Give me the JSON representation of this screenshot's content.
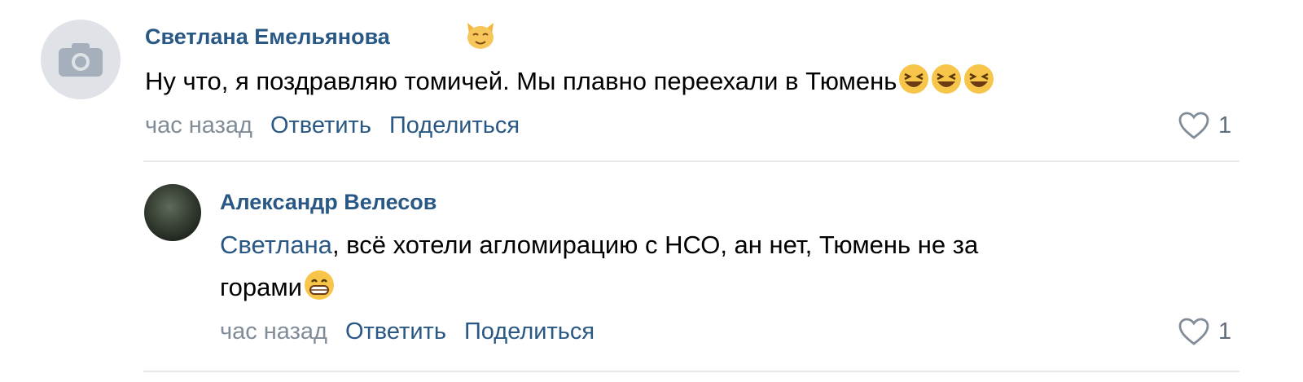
{
  "comments": [
    {
      "author": "Светлана Емельянова",
      "text": "Ну что, я поздравляю томичей. Мы плавно переехали в Тюмень",
      "time": "час назад",
      "reply_label": "Ответить",
      "share_label": "Поделиться",
      "likes": "1"
    },
    {
      "author": "Александр Велесов",
      "mention": "Светлана",
      "text_line1": ", всё хотели агломирацию с НСО, ан нет, Тюмень не за",
      "text_line2": "горами",
      "time": "час назад",
      "reply_label": "Ответить",
      "share_label": "Поделиться",
      "likes": "1"
    }
  ],
  "icons": {
    "avatar_placeholder": "camera-icon",
    "badge": "cat-emoji-icon",
    "laughing": "laughing-emoji-icon",
    "grinning": "grinning-emoji-icon",
    "like": "heart-icon"
  },
  "colors": {
    "link": "#2a5885",
    "meta": "#818c99",
    "divider": "#e7e8ec"
  }
}
